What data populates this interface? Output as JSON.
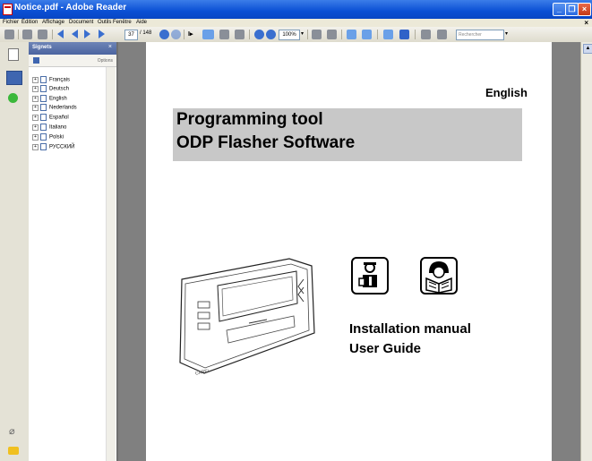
{
  "window": {
    "title": "Notice.pdf - Adobe Reader"
  },
  "menu": [
    "Fichier",
    "Édition",
    "Affichage",
    "Document",
    "Outils",
    "Fenêtre",
    "Aide"
  ],
  "toolbar": {
    "page_current": "37",
    "page_total": "/ 148",
    "zoom": "100%",
    "search_placeholder": "Rechercher"
  },
  "bookmarks": {
    "title": "Signets",
    "options_label": "Options",
    "items": [
      "Français",
      "Deutsch",
      "English",
      "Nederlands",
      "Español",
      "Italiano",
      "Polski",
      "РУССКИЙ"
    ]
  },
  "document": {
    "language": "English",
    "title_line1": "Programming tool",
    "title_line2": "ODP Flasher Software",
    "device_label": "CAREL",
    "manual_line1": "Installation manual",
    "manual_line2": "User Guide"
  },
  "colors": {
    "titlebar": "#0a4fd4",
    "bookmark_header": "#4b64a0",
    "title_box": "#c8c8c8"
  }
}
